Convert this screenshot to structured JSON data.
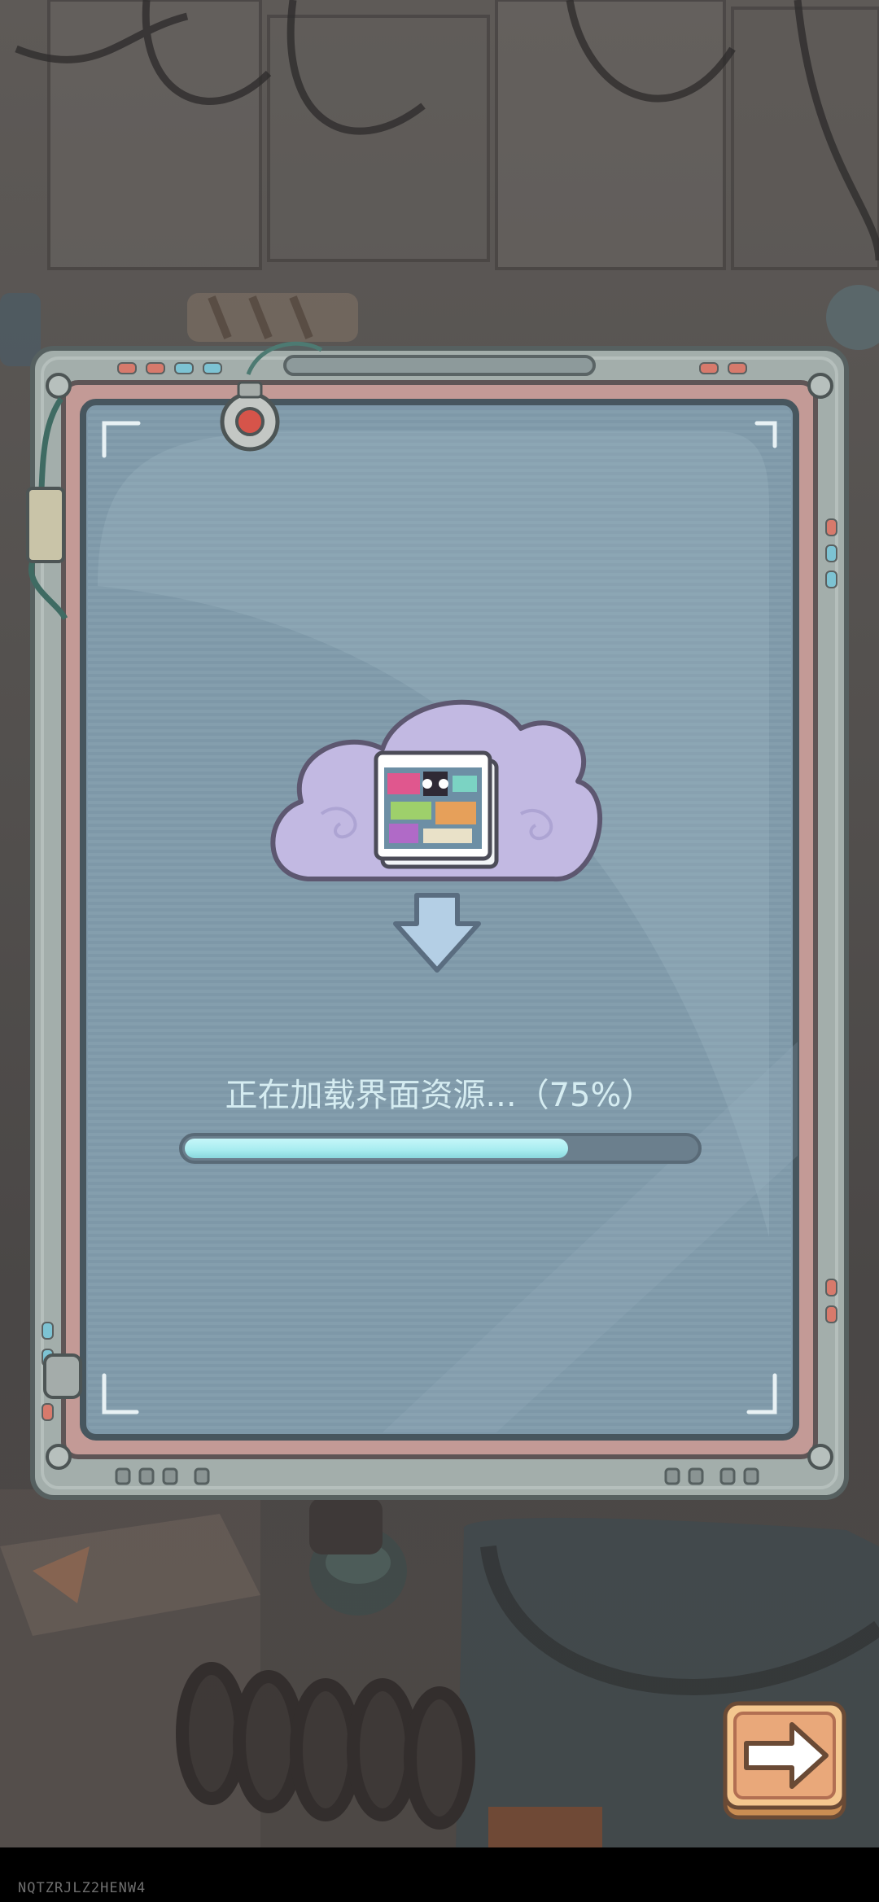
{
  "loading": {
    "label": "正在加载界面资源...（75%）",
    "progress_fraction": 0.75
  },
  "footer": {
    "device_code": "NQTZRJLZ2HENW4"
  },
  "icons": {
    "cloud": "cloud-download-icon",
    "arrow_down": "arrow-down-icon",
    "next": "arrow-right-icon"
  },
  "colors": {
    "screen": "#7e98a8",
    "frame": "#a3aeab",
    "frame_inner": "#c39a96",
    "progress_fill": "#a6ecef",
    "progress_track": "#6b7f8d",
    "cloud": "#c2b9e2",
    "button": "#f4c78f"
  }
}
